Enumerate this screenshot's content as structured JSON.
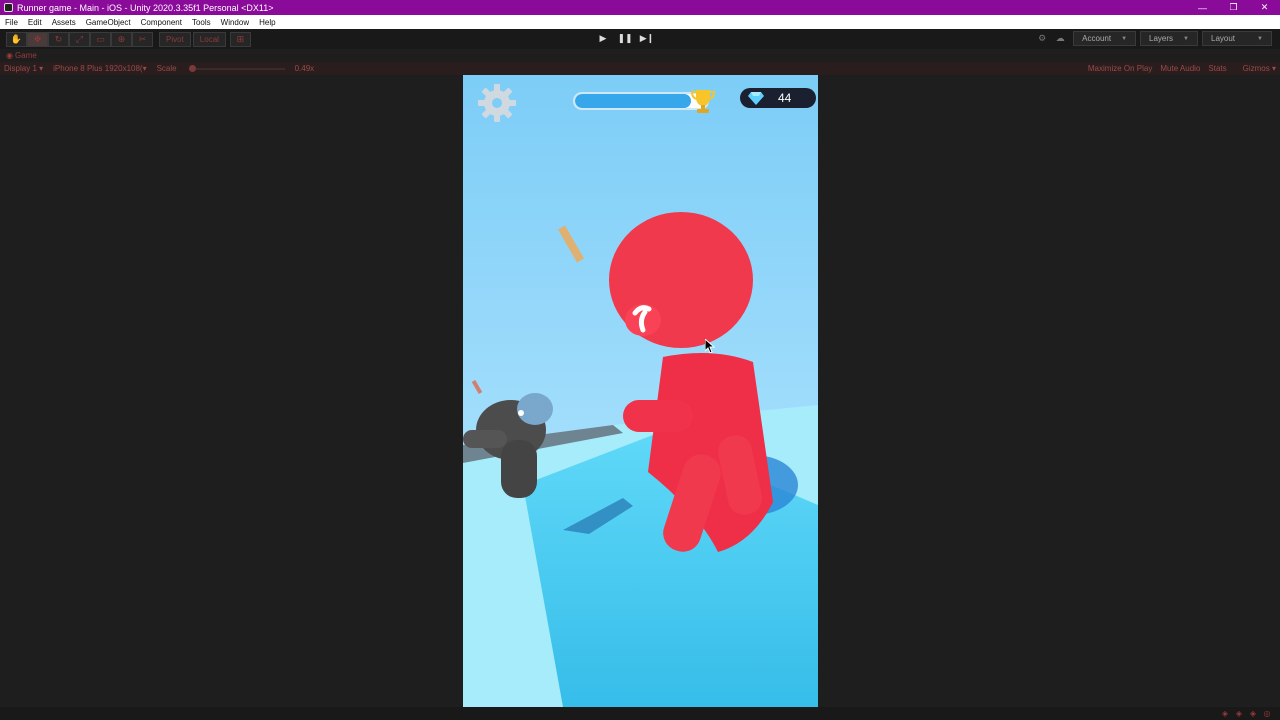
{
  "window": {
    "title": "Runner game - Main - iOS - Unity 2020.3.35f1 Personal <DX11>",
    "controls": [
      "—",
      "❐",
      "✕"
    ]
  },
  "menu": [
    "File",
    "Edit",
    "Assets",
    "GameObject",
    "Component",
    "Tools",
    "Window",
    "Help"
  ],
  "toolbar": {
    "pivot_label": "Pivot",
    "local_label": "Local",
    "account_label": "Account",
    "layers_label": "Layers",
    "layout_label": "Layout"
  },
  "tab": {
    "label": "Game"
  },
  "gamebar": {
    "display": "Display 1",
    "device": "iPhone 8 Plus",
    "resolution": "1920x108(",
    "scale_label": "Scale",
    "scale_value": "0.49x",
    "scale_fraction": 0.0,
    "maximize": "Maximize On Play",
    "mute": "Mute Audio",
    "stats": "Stats",
    "gizmos": "Gizmos"
  },
  "game": {
    "gem_count": "44",
    "level_progress": 0.88,
    "colors": {
      "sky_top": "#8fd6ff",
      "sky_bottom": "#b3e6ff",
      "track": "#43c6f2",
      "player": "#f0334a",
      "enemy": "#4a4a4a",
      "accent": "#8a0a9a"
    }
  },
  "icons": {
    "gear": "gear-icon",
    "trophy": "trophy-icon",
    "gem": "gem-icon"
  }
}
